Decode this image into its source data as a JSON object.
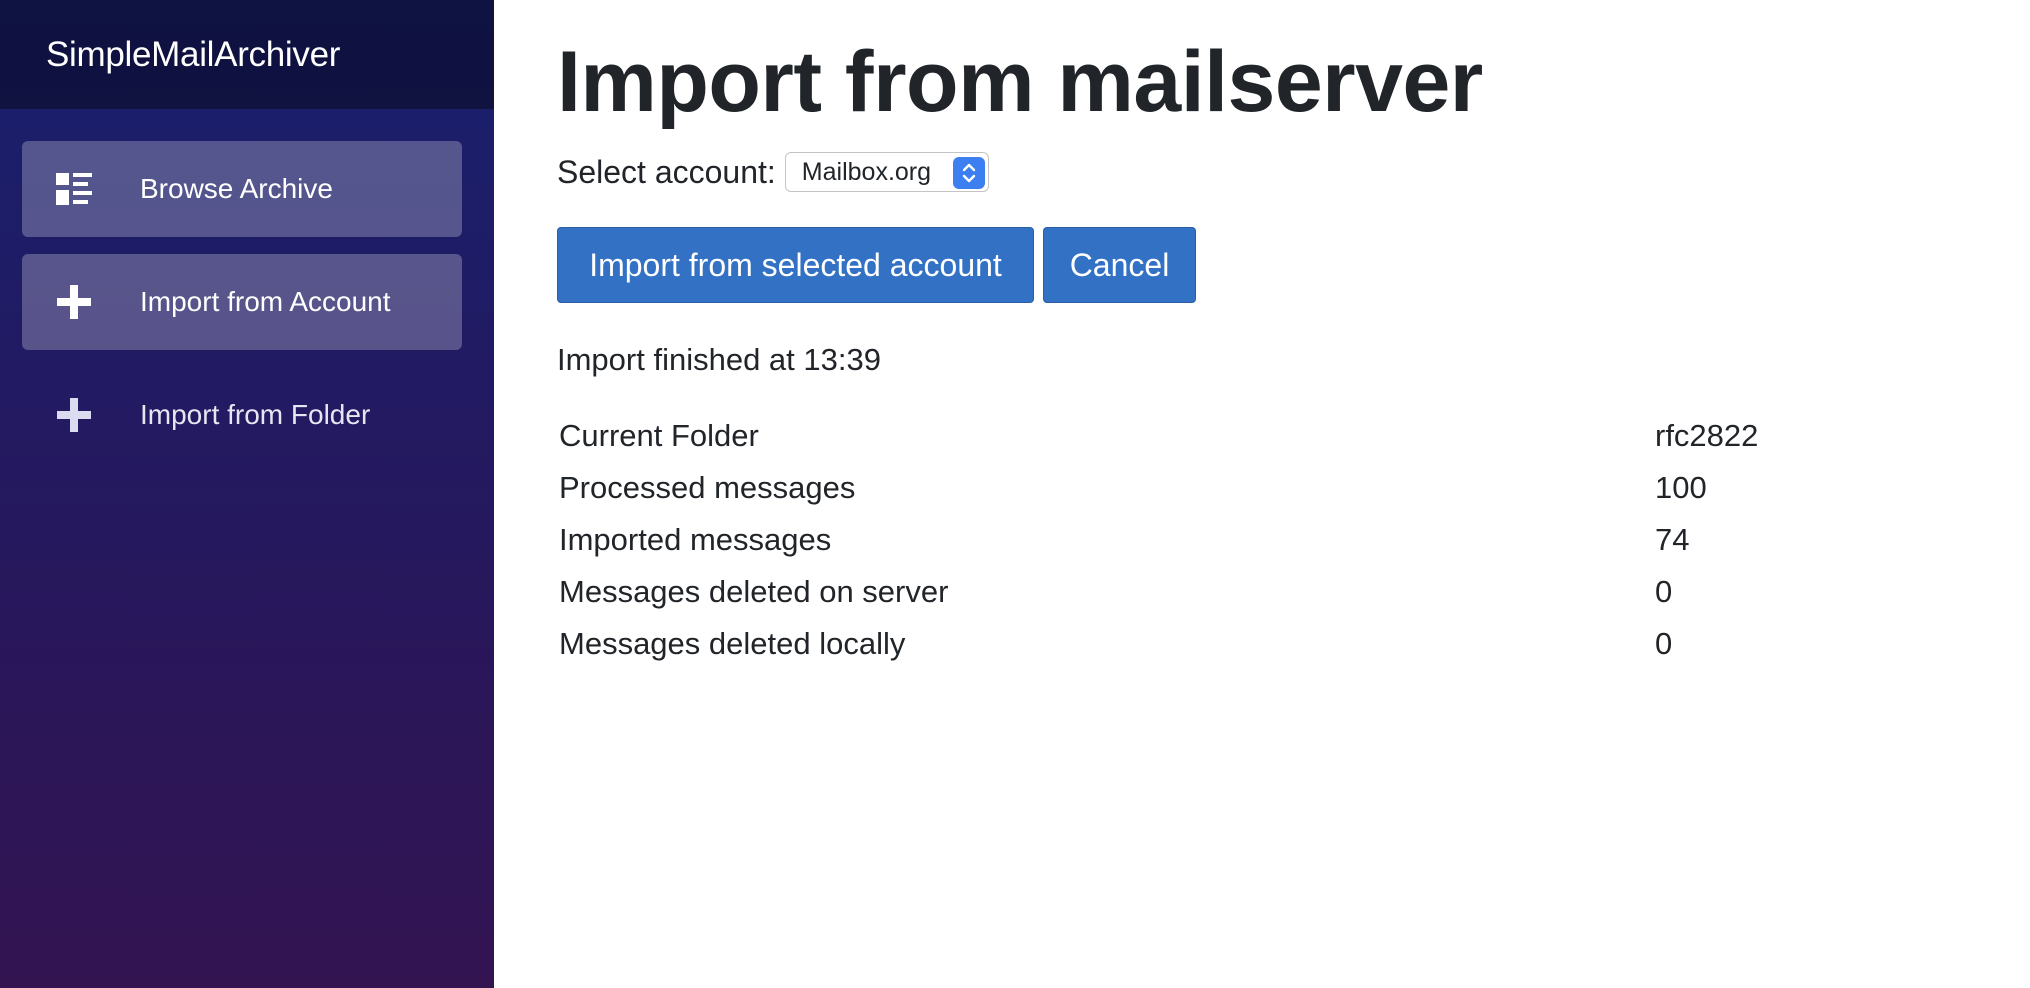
{
  "app": {
    "brand": "SimpleMailArchiver"
  },
  "sidebar": {
    "items": [
      {
        "label": "Browse Archive",
        "icon": "view-list-icon",
        "active": true
      },
      {
        "label": "Import from Account",
        "icon": "plus-icon",
        "active": true
      },
      {
        "label": "Import from Folder",
        "icon": "plus-icon",
        "active": false
      }
    ]
  },
  "main": {
    "title": "Import from mailserver",
    "account_label": "Select account:",
    "account_selected": "Mailbox.org",
    "import_button": "Import from selected account",
    "cancel_button": "Cancel",
    "status": "Import finished at 13:39",
    "stats": [
      {
        "label": "Current Folder",
        "value": "rfc2822"
      },
      {
        "label": "Processed messages",
        "value": "100"
      },
      {
        "label": "Imported messages",
        "value": "74"
      },
      {
        "label": "Messages deleted on server",
        "value": "0"
      },
      {
        "label": "Messages deleted locally",
        "value": "0"
      }
    ]
  },
  "colors": {
    "sidebar_top": "#18206e",
    "sidebar_bottom": "#331451",
    "button_primary": "#3271c4",
    "select_accent": "#3b7ff0"
  }
}
